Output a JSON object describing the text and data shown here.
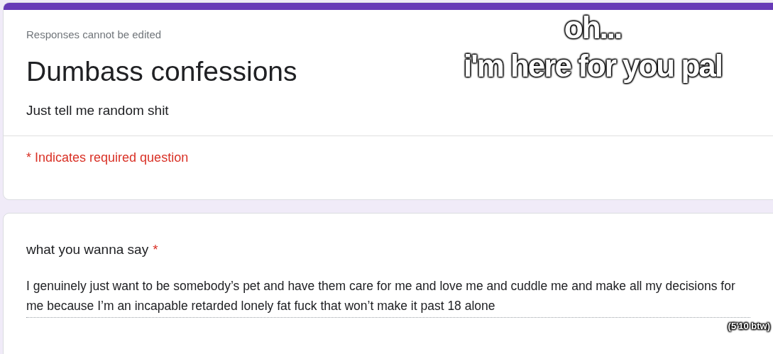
{
  "form_header": {
    "notice": "Responses cannot be edited",
    "title": "Dumbass confessions",
    "description": "Just tell me random shit",
    "required_note": "* Indicates required question"
  },
  "question": {
    "label": "what you wanna say",
    "required_mark": "*",
    "answer": "I genuinely just want to be somebody’s pet and have them care for me and love me and cuddle me and make all my decisions for me because I’m an incapable retarded lonely fat fuck that won’t make it past 18 alone"
  },
  "captions": [
    {
      "kind": "top",
      "lines": [
        "oh...",
        "i'm here for you pal"
      ]
    },
    {
      "kind": "bottom",
      "lines": [
        "(5'10 btw)"
      ]
    }
  ]
}
